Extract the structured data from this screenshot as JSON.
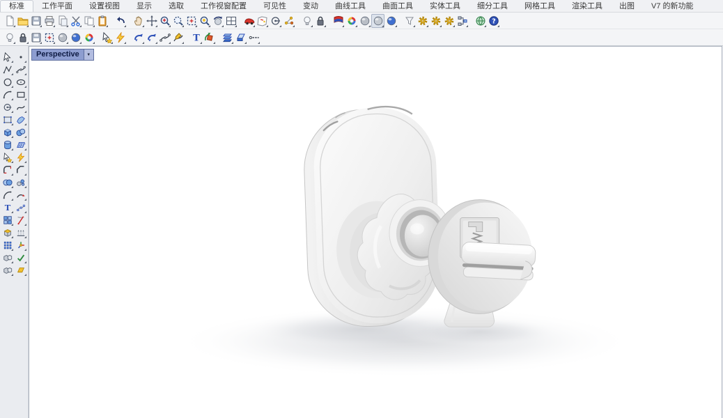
{
  "colors": {
    "chrome_bg": "#f0f1f4",
    "toolbar_bg": "#f4f5f7",
    "sidebar_bg": "#eaecf0",
    "viewport_bg": "#ffffff",
    "viewport_border": "#aab2be",
    "tab_bg": "#8d9dd0",
    "tab_text": "#0f1c44",
    "menu_text": "#3a3a3a"
  },
  "menu": {
    "items": [
      "标准",
      "工作平面",
      "设置视图",
      "显示",
      "选取",
      "工作视窗配置",
      "可见性",
      "变动",
      "曲线工具",
      "曲面工具",
      "实体工具",
      "细分工具",
      "网格工具",
      "渲染工具",
      "出图",
      "V7 的新功能"
    ],
    "active_index": 0
  },
  "toolbar_row1": {
    "buttons": [
      {
        "n": "new-file",
        "t": "page"
      },
      {
        "n": "open-file",
        "t": "folder"
      },
      {
        "n": "save",
        "t": "floppy"
      },
      {
        "n": "print",
        "t": "printer"
      },
      {
        "n": "copy-to-clipboard",
        "t": "pagecopy"
      },
      {
        "n": "cut",
        "t": "scissors"
      },
      {
        "n": "copy",
        "t": "copy"
      },
      {
        "n": "paste",
        "t": "clipboard"
      },
      {
        "n": "undo",
        "t": "undo",
        "g": 1
      },
      {
        "n": "pan",
        "t": "hand",
        "g": 1
      },
      {
        "n": "rotate-view",
        "t": "move4"
      },
      {
        "n": "zoom-in",
        "t": "mag",
        "v": "plus"
      },
      {
        "n": "zoom-dynamic",
        "t": "mag",
        "v": "dash"
      },
      {
        "n": "zoom-extents",
        "t": "dashbox"
      },
      {
        "n": "zoom-selected",
        "t": "mag",
        "v": "dot"
      },
      {
        "n": "rotate-camera",
        "t": "rotsphere"
      },
      {
        "n": "viewport-layout",
        "t": "grid4"
      },
      {
        "n": "named-view",
        "t": "car",
        "g": 1
      },
      {
        "n": "cplane-map",
        "t": "map"
      },
      {
        "n": "set-view",
        "t": "circledot"
      },
      {
        "n": "named-position",
        "t": "nodes"
      },
      {
        "n": "light",
        "t": "bulb",
        "g": 1
      },
      {
        "n": "lock",
        "t": "lock"
      },
      {
        "n": "display-mode-flag",
        "t": "flag",
        "g": 1
      },
      {
        "n": "rendered-display",
        "t": "colorwheel"
      },
      {
        "n": "shaded-display",
        "t": "sphere",
        "c": "#b9bec6"
      },
      {
        "n": "ghosted-display",
        "t": "sphere",
        "c": "#c6cbd2",
        "pressed": true
      },
      {
        "n": "raytraced-display",
        "t": "sphere",
        "c": "#3f6fd0"
      },
      {
        "n": "selection-filter",
        "t": "funnel",
        "g": 1
      },
      {
        "n": "settings-gear-1",
        "t": "gear"
      },
      {
        "n": "settings-gear-2",
        "t": "gear"
      },
      {
        "n": "settings-gear-3",
        "t": "gear"
      },
      {
        "n": "record-history",
        "t": "tree"
      },
      {
        "n": "web-browser",
        "t": "globe",
        "g": 1
      },
      {
        "n": "help",
        "t": "question"
      }
    ]
  },
  "toolbar_row2": {
    "buttons": [
      {
        "n": "light-small",
        "t": "bulb"
      },
      {
        "n": "lock-small",
        "t": "lock"
      },
      {
        "n": "save-small",
        "t": "floppy"
      },
      {
        "n": "zoom-extents-small",
        "t": "dashbox"
      },
      {
        "n": "shaded-sphere",
        "t": "sphere",
        "c": "#b9bec6"
      },
      {
        "n": "rendered-sphere",
        "t": "sphere",
        "c": "#3f6fd0"
      },
      {
        "n": "color-wheel",
        "t": "colorwheel"
      },
      {
        "n": "select-transform",
        "t": "cursorstar",
        "g": 1
      },
      {
        "n": "explode",
        "t": "lightning"
      },
      {
        "n": "flip-direction-1",
        "t": "swirl",
        "g": 1
      },
      {
        "n": "flip-direction-2",
        "t": "swirl"
      },
      {
        "n": "curve-points",
        "t": "curvepts"
      },
      {
        "n": "curve-sketch",
        "t": "curvepencil"
      },
      {
        "n": "dimension-text",
        "t": "textT",
        "g": 1
      },
      {
        "n": "rotate-3d",
        "t": "rot3d"
      },
      {
        "n": "layers",
        "t": "layers",
        "g": 1
      },
      {
        "n": "delete",
        "t": "eraser"
      },
      {
        "n": "linetype",
        "t": "dashline"
      }
    ]
  },
  "sidebar": {
    "buttons": [
      {
        "n": "select-cursor",
        "t": "cursor"
      },
      {
        "n": "point",
        "t": "point"
      },
      {
        "n": "polyline",
        "t": "polyline"
      },
      {
        "n": "curve-control-points",
        "t": "curvepts"
      },
      {
        "n": "circle",
        "t": "circleI"
      },
      {
        "n": "ellipse",
        "t": "ellipseI"
      },
      {
        "n": "arc",
        "t": "arc"
      },
      {
        "n": "rectangle",
        "t": "rectI"
      },
      {
        "n": "polygon-center",
        "t": "circledot"
      },
      {
        "n": "freeform-curve",
        "t": "freeline"
      },
      {
        "n": "surface-from-points",
        "t": "srfpts"
      },
      {
        "n": "surface-patch",
        "t": "patch"
      },
      {
        "n": "box",
        "t": "box3d"
      },
      {
        "n": "spheres",
        "t": "spheres2"
      },
      {
        "n": "cylinder",
        "t": "cylinder"
      },
      {
        "n": "mesh-surface",
        "t": "mesh"
      },
      {
        "n": "transform-tools",
        "t": "cursorstar"
      },
      {
        "n": "explode-tools",
        "t": "lightning"
      },
      {
        "n": "fillet-corner",
        "t": "filletL"
      },
      {
        "n": "chamfer-corner",
        "t": "chamferL"
      },
      {
        "n": "boolean-union",
        "t": "boolunion"
      },
      {
        "n": "boolean-small",
        "t": "booldots"
      },
      {
        "n": "curve-fillet",
        "t": "arc"
      },
      {
        "n": "extend-curve",
        "t": "extend"
      },
      {
        "n": "text-object",
        "t": "textT"
      },
      {
        "n": "edit-points",
        "t": "pointedit"
      },
      {
        "n": "block-tools",
        "t": "blocks"
      },
      {
        "n": "trim",
        "t": "trim"
      },
      {
        "n": "solid-face-edit",
        "t": "solidface"
      },
      {
        "n": "hatch",
        "t": "hatch"
      },
      {
        "n": "array",
        "t": "arraydots"
      },
      {
        "n": "gumball",
        "t": "gumball"
      },
      {
        "n": "visibility-solids",
        "t": "graysolids"
      },
      {
        "n": "check-objects",
        "t": "check"
      },
      {
        "n": "gray-solids",
        "t": "graysolids"
      },
      {
        "n": "gold-surface",
        "t": "goldsrf"
      }
    ]
  },
  "viewport": {
    "label": "Perspective",
    "dropdown_icon": "▼"
  }
}
